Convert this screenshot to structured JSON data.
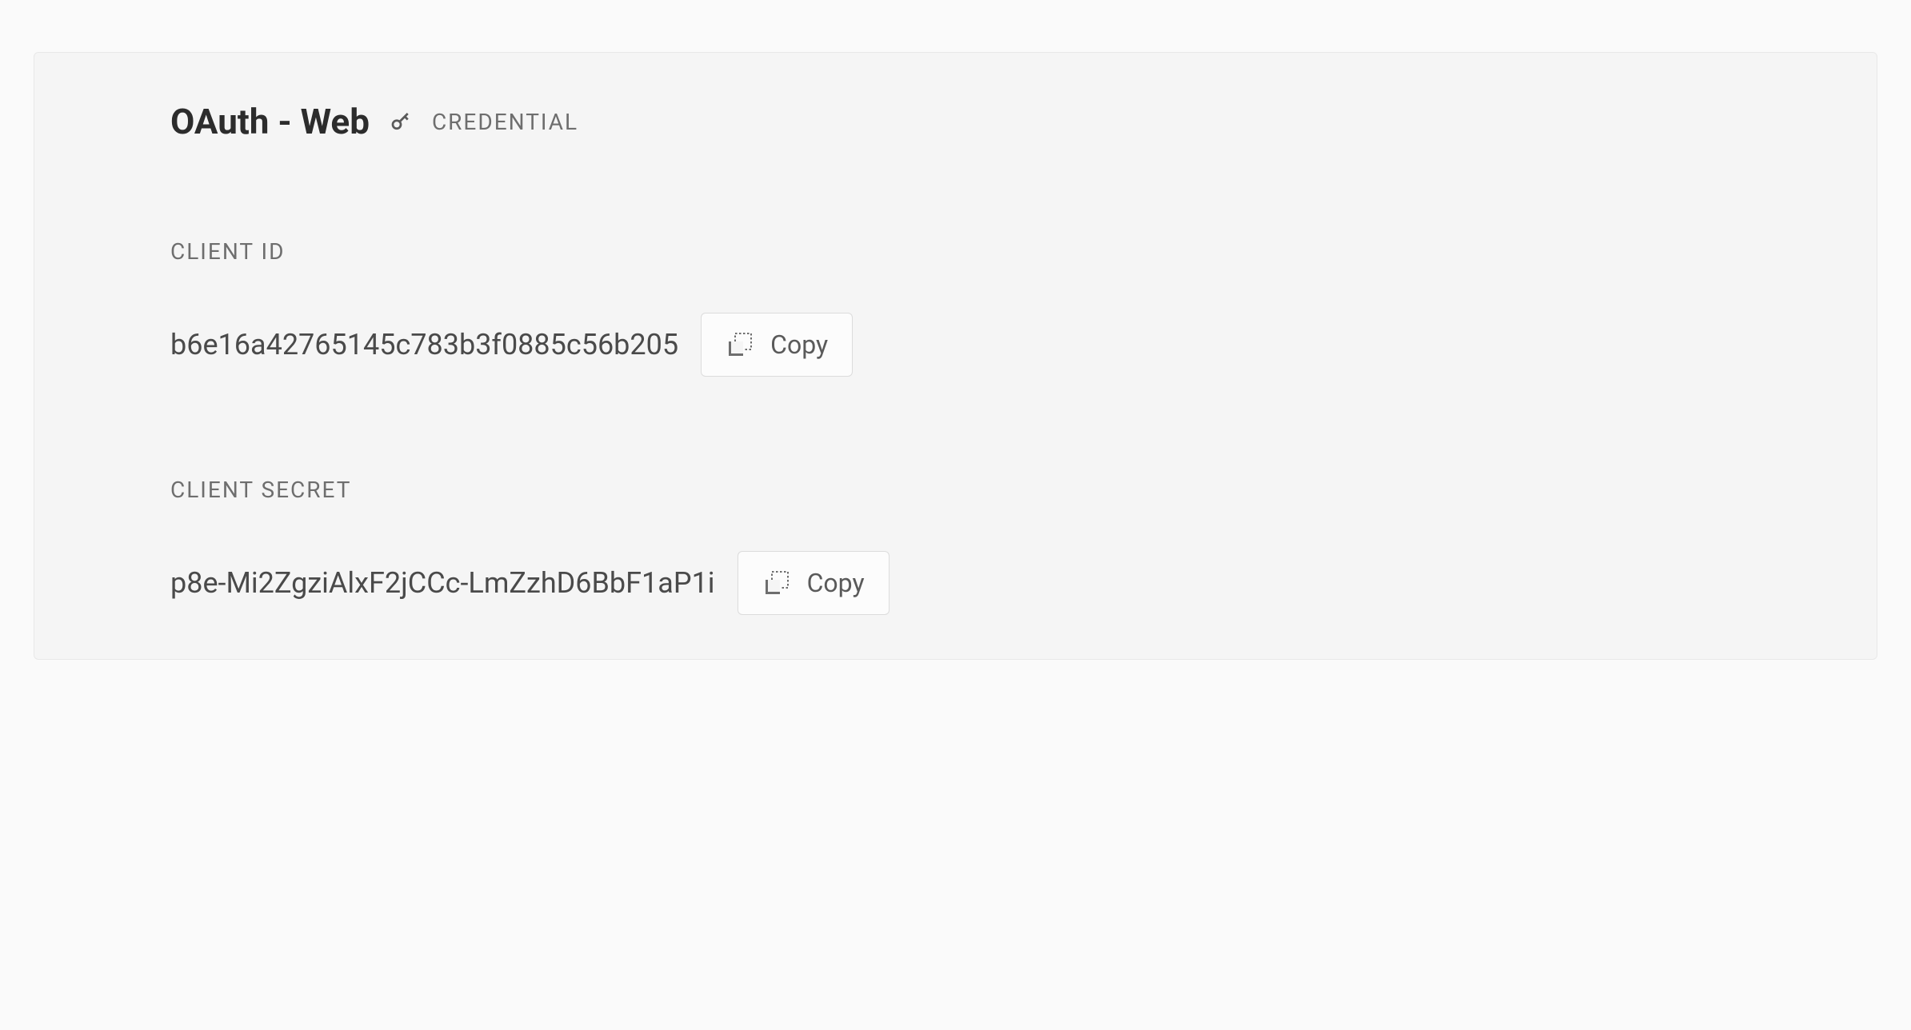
{
  "header": {
    "title": "OAuth - Web",
    "badge": "CREDENTIAL"
  },
  "fields": {
    "clientId": {
      "label": "CLIENT ID",
      "value": "b6e16a42765145c783b3f0885c56b205",
      "copyLabel": "Copy"
    },
    "clientSecret": {
      "label": "CLIENT SECRET",
      "value": "p8e-Mi2ZgziAlxF2jCCc-LmZzhD6BbF1aP1i",
      "copyLabel": "Copy"
    }
  }
}
